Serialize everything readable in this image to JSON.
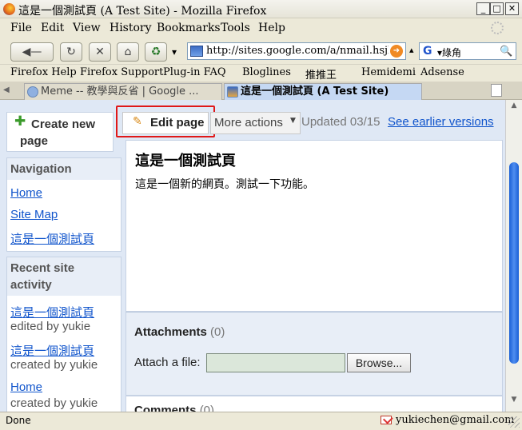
{
  "window": {
    "title": "這是一個測試頁 (A Test Site) - Mozilla Firefox",
    "minimize": "_",
    "maximize": "□",
    "close": "✕"
  },
  "menu": [
    "File",
    "Edit",
    "View",
    "History",
    "Bookmarks",
    "Tools",
    "Help"
  ],
  "toolbar": {
    "back": "◀—",
    "reload": "↻",
    "stop": "✕",
    "home": "⌂",
    "restore": "♻",
    "dropdown": "▾",
    "url": "http://sites.google.com/a/nmail.hsjh.tc.edu.tw/test/",
    "go": "➜",
    "history_dropdown": "▴",
    "search_engine": "G",
    "search_text": "▾綠角",
    "search_button": "🔍"
  },
  "bookmarks": [
    "Firefox Help",
    "Firefox Support",
    "Plug-in FAQ",
    "Bloglines",
    "推推王",
    "Hemidemi",
    "Adsense"
  ],
  "tabs": [
    {
      "label": "Meme -- 教學與反省 | Google ...",
      "active": false
    },
    {
      "label": "這是一個測試頁 (A Test Site)",
      "active": true
    }
  ],
  "sidebar": {
    "create_plus": "✚",
    "create_label": "Create new page",
    "navigation_title": "Navigation",
    "nav_items": [
      "Home",
      "Site Map",
      "這是一個測試頁"
    ],
    "recent_title": "Recent site activity",
    "recent": [
      {
        "link": "這是一個測試頁",
        "meta": "edited by yukie"
      },
      {
        "link": "這是一個測試頁",
        "meta": "created by yukie"
      },
      {
        "link": "Home",
        "meta": "created by yukie"
      }
    ]
  },
  "actions": {
    "edit_icon": "✎",
    "edit_label": "Edit page",
    "more_label": "More actions",
    "more_caret": "▼",
    "updated": "Updated 03/15",
    "earlier": "See earlier versions"
  },
  "page": {
    "title": "這是一個測試頁",
    "text": "這是一個新的網頁。測試一下功能。"
  },
  "attachments": {
    "title": "Attachments",
    "count": "(0)",
    "attach_label": "Attach a file:",
    "browse_label": "Browse..."
  },
  "comments": {
    "title": "Comments",
    "count": "(0)"
  },
  "status": {
    "text": "Done",
    "email": "yukiechen@gmail.com"
  },
  "colors": {
    "link": "#1155cc",
    "highlight_box": "#e01818",
    "content_bg": "#dfe8f5",
    "scroll_thumb": "#1a5fd6"
  }
}
